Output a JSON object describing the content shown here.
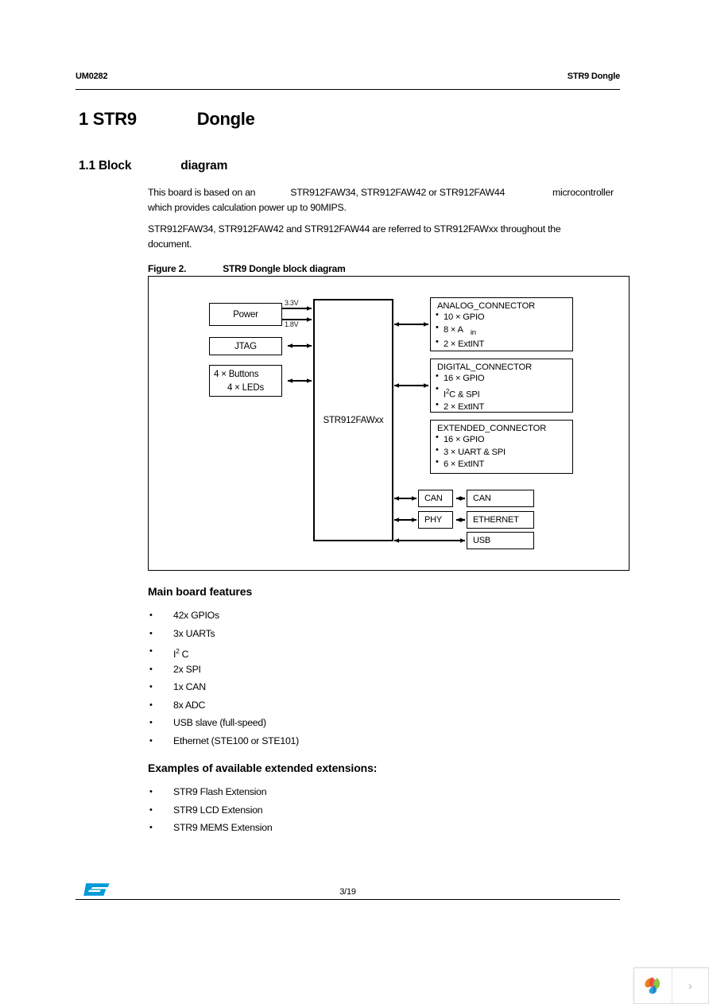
{
  "header": {
    "doc_id": "UM0282",
    "doc_title": "STR9 Dongle"
  },
  "headings": {
    "h1_number": "1 STR9",
    "h1_text": "Dongle",
    "h2_number": "1.1 Block",
    "h2_text": "diagram"
  },
  "body": {
    "para1_a": "This board is based on an",
    "para1_b": "STR912FAW34, STR912FAW42 or STR912FAW44",
    "para1_c": "microcontroller",
    "para1_d": "which provides calculation power up to 90MIPS.",
    "para2": "STR912FAW34, STR912FAW42 and STR912FAW44 are referred to STR912FAWxx throughout the document."
  },
  "figure": {
    "caption_label": "Figure 2.",
    "caption_text": "STR9 Dongle block diagram",
    "mcu": "STR912FAWxx",
    "left_blocks": {
      "power": "Power",
      "jtag": "JTAG",
      "buttons": "4 × Buttons",
      "leds": "4 × LEDs"
    },
    "voltages": {
      "v33": "3.3V",
      "v18": "1.8V"
    },
    "connectors": [
      {
        "title": "ANALOG_CONNECTOR",
        "items": [
          "10 × GPIO",
          "8 × A",
          "2 × ExtINT"
        ],
        "subscript": "in"
      },
      {
        "title": "DIGITAL_CONNECTOR",
        "items": [
          "16 × GPIO",
          "I",
          "C & SPI",
          "2 × ExtINT"
        ],
        "superscript": "2"
      },
      {
        "title": "EXTENDED_CONNECTOR",
        "items": [
          "16 × GPIO",
          "3 × UART & SPI",
          "6 × ExtINT"
        ]
      }
    ],
    "peripherals": {
      "can_ctrl": "CAN",
      "phy_ctrl": "PHY",
      "can_conn": "CAN",
      "eth_conn": "ETHERNET",
      "usb_conn": "USB"
    }
  },
  "features": {
    "title": "Main board features",
    "items": [
      "42x GPIOs",
      "3x UARTs",
      "I",
      "2x SPI",
      "1x CAN",
      "8x ADC",
      "USB slave (full-speed)",
      "Ethernet (STE100 or STE101)"
    ],
    "i2c_sup": "2",
    "i2c_tail": "C"
  },
  "extensions": {
    "title": "Examples of available extended extensions:",
    "items": [
      "STR9 Flash Extension",
      "STR9 LCD Extension",
      "STR9 MEMS Extension"
    ]
  },
  "footer": {
    "page_number": "3/19",
    "logo_color": "#0099d8"
  },
  "widget": {
    "next_glyph": "›"
  }
}
